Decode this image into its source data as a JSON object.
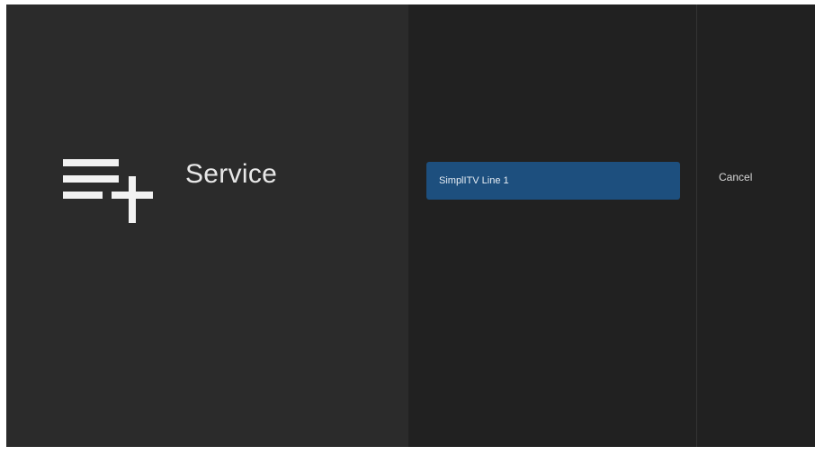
{
  "header": {
    "title": "Service",
    "icon": "playlist-add-icon"
  },
  "service_list": {
    "items": [
      {
        "label": "SimplITV Line 1",
        "selected": true
      }
    ]
  },
  "actions": {
    "cancel_label": "Cancel"
  },
  "colors": {
    "background_dark": "#282828",
    "panel": "#212121",
    "selected_item": "#1d4f7e",
    "text": "#e8e8e8"
  }
}
